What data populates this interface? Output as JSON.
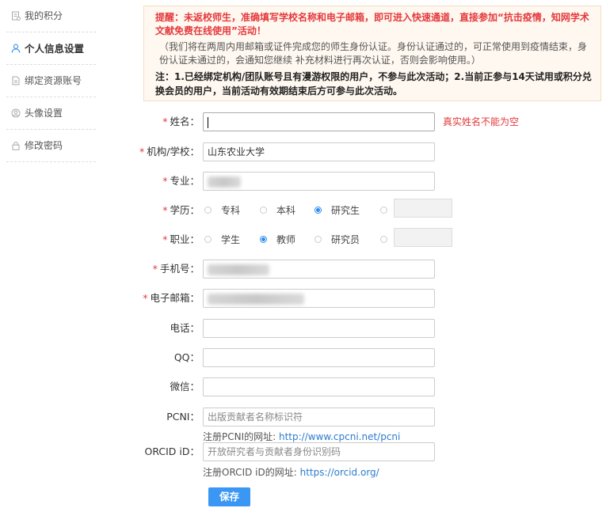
{
  "sidebar": {
    "items": [
      {
        "label": "我的积分",
        "icon": "points-icon",
        "active": false
      },
      {
        "label": "个人信息设置",
        "icon": "user-icon",
        "active": true
      },
      {
        "label": "绑定资源账号",
        "icon": "document-icon",
        "active": false
      },
      {
        "label": "头像设置",
        "icon": "avatar-icon",
        "active": false
      },
      {
        "label": "修改密码",
        "icon": "lock-icon",
        "active": false
      }
    ]
  },
  "notice": {
    "line_red": "提醒：未返校师生，准确填写学校名称和电子邮箱，即可进入快速通道，直接参加“抗击疫情，知网学术文献免费在线使用”活动！",
    "line_gray": "（我们将在两周内用邮箱或证件完成您的师生身份认证。身份认证通过的，可正常使用到疫情结束，身份认证未通过的，会通知您继续 补充材料进行再次认证，否则会影响使用。）",
    "line_bold": "注：1.已经绑定机构/团队账号且有漫游权限的用户，不参与此次活动；2.当前正参与14天试用或积分兑换会员的用户，当前活动有效期结束后方可参与此次活动。"
  },
  "form": {
    "required_mark": "*",
    "name": {
      "label": "姓名：",
      "value": "",
      "error": "真实姓名不能为空"
    },
    "institution": {
      "label": "机构/学校：",
      "value": "山东农业大学"
    },
    "major": {
      "label": "专业："
    },
    "education": {
      "label": "学历：",
      "options": [
        "专科",
        "本科",
        "研究生"
      ],
      "selected": "研究生"
    },
    "occupation": {
      "label": "职业：",
      "options": [
        "学生",
        "教师",
        "研究员"
      ],
      "selected": "教师"
    },
    "mobile": {
      "label": "手机号："
    },
    "email": {
      "label": "电子邮箱："
    },
    "phone": {
      "label": "电话：",
      "value": ""
    },
    "qq": {
      "label": "QQ：",
      "value": ""
    },
    "wechat": {
      "label": "微信：",
      "value": ""
    },
    "pcni": {
      "label": "PCNI：",
      "placeholder": "出版贡献者名称标识符",
      "hint_text": "注册PCNI的网址: ",
      "hint_link": "http://www.cpcni.net/pcni"
    },
    "orcid": {
      "label": "ORCID iD：",
      "placeholder": "开放研究者与贡献者身份识别码",
      "hint_text": "注册ORCID iD的网址: ",
      "hint_link": "https://orcid.org/"
    },
    "save_label": "保存"
  },
  "colors": {
    "accent": "#3a97f4",
    "error": "#e4393c",
    "link": "#2b7bd0",
    "notice_bg": "#fff8f0"
  }
}
